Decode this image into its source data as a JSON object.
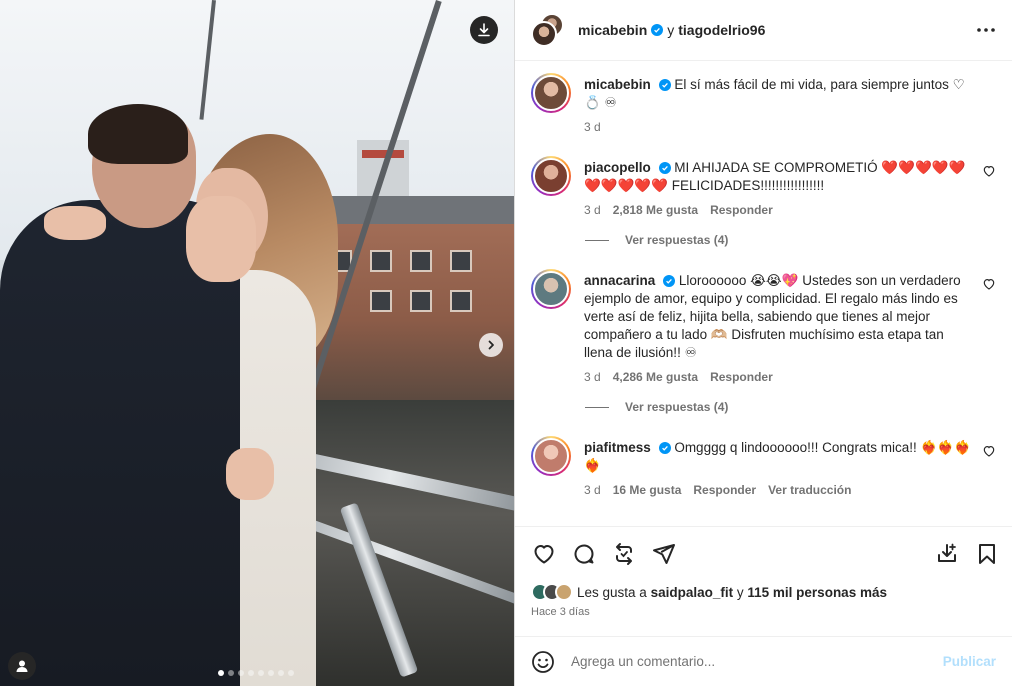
{
  "header": {
    "user1": "micabebin",
    "conjunction": "y",
    "user2": "tiagodelrio96"
  },
  "comments": [
    {
      "user": "micabebin",
      "verified": true,
      "text": "El sí más fácil de mi vida, para siempre juntos ♡💍 ♾",
      "time": "3 d",
      "avatar_color": "#c49a80"
    },
    {
      "user": "piacopello",
      "verified": true,
      "text": "MI AHIJADA SE COMPROMETIÓ ❤️❤️❤️❤️❤️ ❤️❤️❤️❤️❤️ FELICIDADES!!!!!!!!!!!!!!!!!",
      "time": "3 d",
      "likes": "2,818 Me gusta",
      "reply": "Responder",
      "view_replies": "Ver respuestas (4)",
      "avatar_color": "#b36b57"
    },
    {
      "user": "annacarina",
      "verified": true,
      "text": "Lloroooooo 😭😭💖 Ustedes son un verdadero ejemplo de amor, equipo y complicidad. El regalo más lindo es verte así de feliz, hijita bella, sabiendo que tienes al mejor compañero a tu lado 🫶🏼 Disfruten muchísimo esta etapa tan llena de ilusión!! ♾",
      "time": "3 d",
      "likes": "4,286 Me gusta",
      "reply": "Responder",
      "view_replies": "Ver respuestas (4)",
      "avatar_color": "#8aa3a8"
    },
    {
      "user": "piafitmess",
      "verified": true,
      "text": "Omgggg q lindoooooo!!! Congrats mica!! ❤️‍🔥❤️‍🔥❤️‍🔥❤️‍🔥",
      "time": "3 d",
      "likes": "16 Me gusta",
      "reply": "Responder",
      "translate": "Ver traducción",
      "avatar_color": "#d79a8c"
    }
  ],
  "likes": {
    "prefix": "Les gusta a",
    "user": "saidpalao_fit",
    "middle": "y",
    "others": "115 mil personas más"
  },
  "posted": "Hace 3 días",
  "add_comment": {
    "placeholder": "Agrega un comentario...",
    "post_label": "Publicar"
  },
  "carousel": {
    "slides": 8,
    "active": 1
  },
  "colors": {
    "accent": "#0095f6",
    "post_disabled": "#b2dffc",
    "muted": "#737373"
  }
}
